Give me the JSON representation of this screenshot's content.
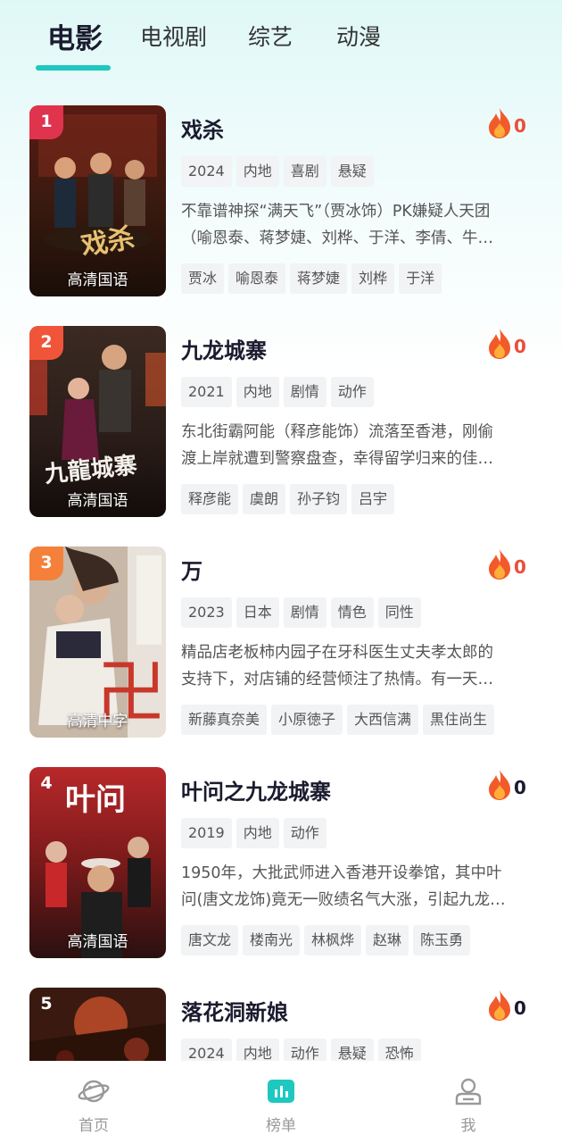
{
  "tabs": [
    {
      "label": "电影",
      "active": true
    },
    {
      "label": "电视剧",
      "active": false
    },
    {
      "label": "综艺",
      "active": false
    },
    {
      "label": "动漫",
      "active": false
    }
  ],
  "accent_color": "#1ec8c0",
  "items": [
    {
      "rank": "1",
      "rank_color": "#e0334e",
      "title": "戏杀",
      "heat": "0",
      "tags": [
        "2024",
        "内地",
        "喜剧",
        "悬疑"
      ],
      "desc_lines": [
        "不靠谱神探“满天飞”（贾冰饰）PK嫌疑人天团",
        "（喻恩泰、蒋梦婕、刘桦、于洋、李倩、牛…"
      ],
      "cast": [
        "贾冰",
        "喻恩泰",
        "蒋梦婕",
        "刘桦",
        "于洋"
      ],
      "poster_label": "高清国语",
      "poster_title": "戏杀"
    },
    {
      "rank": "2",
      "rank_color": "#f0553a",
      "title": "九龙城寨",
      "heat": "0",
      "tags": [
        "2021",
        "内地",
        "剧情",
        "动作"
      ],
      "desc_lines": [
        "东北街霸阿能（释彦能饰）流落至香港，刚偷",
        "渡上岸就遭到警察盘查，幸得留学归来的佳…"
      ],
      "cast": [
        "释彦能",
        "虞朗",
        "孙子钧",
        "吕宇"
      ],
      "poster_label": "高清国语",
      "poster_title": "九龍城寨"
    },
    {
      "rank": "3",
      "rank_color": "#f5803a",
      "title": "万",
      "heat": "0",
      "tags": [
        "2023",
        "日本",
        "剧情",
        "情色",
        "同性"
      ],
      "desc_lines": [
        "精品店老板柿内园子在牙科医生丈夫孝太郎的",
        "支持下，对店铺的经营倾注了热情。有一天…"
      ],
      "cast": [
        "新藤真奈美",
        "小原徳子",
        "大西信满",
        "黒住尚生"
      ],
      "poster_label": "高清中字",
      "poster_title": "卍"
    },
    {
      "rank": "4",
      "rank_color": "",
      "title": "叶问之九龙城寨",
      "heat": "0",
      "tags": [
        "2019",
        "内地",
        "动作"
      ],
      "desc_lines": [
        "1950年，大批武师进入香港开设拳馆，其中叶",
        "问(唐文龙饰)竟无一败绩名气大涨，引起九龙…"
      ],
      "cast": [
        "唐文龙",
        "楼南光",
        "林枫烨",
        "赵琳",
        "陈玉勇"
      ],
      "poster_label": "高清国语",
      "poster_title": "叶问"
    },
    {
      "rank": "5",
      "rank_color": "",
      "title": "落花洞新娘",
      "heat": "0",
      "tags": [
        "2024",
        "内地",
        "动作",
        "悬疑",
        "恐怖"
      ],
      "desc_lines": [
        "",
        ""
      ],
      "cast": [],
      "poster_label": "",
      "poster_title": ""
    }
  ],
  "nav": [
    {
      "label": "首页",
      "icon": "planet-icon",
      "active": false
    },
    {
      "label": "榜单",
      "icon": "chart-icon",
      "active": true
    },
    {
      "label": "我",
      "icon": "user-icon",
      "active": false
    }
  ]
}
